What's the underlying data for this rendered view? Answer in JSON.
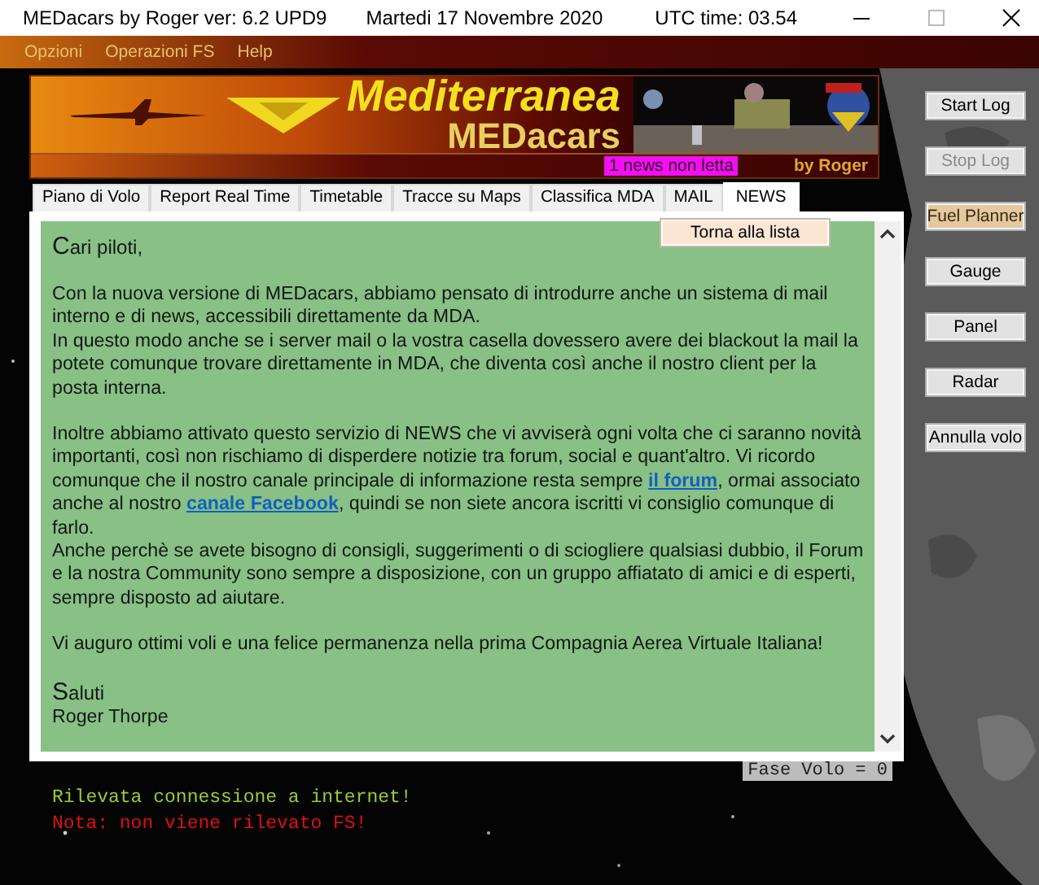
{
  "window": {
    "title": "MEDacars by Roger ver: 6.2 UPD9",
    "date": "Martedi 17 Novembre 2020",
    "utc": "UTC time: 03.54"
  },
  "menu": [
    "Opzioni",
    "Operazioni FS",
    "Help"
  ],
  "banner": {
    "title": "Mediterranea",
    "subtitle": "MEDacars",
    "badge": "1 news non letta",
    "credit": "by Roger"
  },
  "tabs": [
    {
      "label": "Piano di Volo",
      "selected": false
    },
    {
      "label": "Report Real Time",
      "selected": false
    },
    {
      "label": "Timetable",
      "selected": false
    },
    {
      "label": "Tracce su Maps",
      "selected": false
    },
    {
      "label": "Classifica MDA",
      "selected": false
    },
    {
      "label": "MAIL",
      "selected": false
    },
    {
      "label": "NEWS",
      "selected": true
    }
  ],
  "back_button": "Torna alla lista",
  "news": [
    [
      {
        "kind": "heading",
        "parts": [
          {
            "kind": "text",
            "text": "Cari piloti,"
          }
        ]
      }
    ],
    [
      {
        "kind": "text",
        "parts": [
          {
            "kind": "text",
            "text": "Con la nuova versione di MEDacars, abbiamo pensato di introdurre anche un sistema di mail interno e di news, accessibili direttamente da MDA."
          }
        ]
      },
      {
        "kind": "text",
        "parts": [
          {
            "kind": "text",
            "text": "In questo modo anche se i server mail o la vostra casella dovessero avere dei blackout la mail la potete comunque trovare direttamente in MDA, che diventa così anche il nostro client per la posta interna."
          }
        ]
      }
    ],
    [
      {
        "kind": "text",
        "parts": [
          {
            "kind": "text",
            "text": "Inoltre abbiamo attivato questo servizio di NEWS che vi avviserà ogni volta che ci saranno novità importanti, così non rischiamo di disperdere notizie tra forum, social e quant'altro. Vi ricordo comunque che il nostro canale principale di informazione resta sempre "
          },
          {
            "kind": "link",
            "text": "il forum"
          },
          {
            "kind": "text",
            "text": ", ormai associato anche al nostro "
          },
          {
            "kind": "link",
            "text": "canale Facebook"
          },
          {
            "kind": "text",
            "text": ", quindi se non siete ancora iscritti vi consiglio comunque di farlo."
          }
        ]
      },
      {
        "kind": "text",
        "parts": [
          {
            "kind": "text",
            "text": "Anche perchè se avete bisogno di consigli, suggerimenti o di sciogliere qualsiasi dubbio, il Forum e la nostra Community sono sempre a disposizione, con un gruppo affiatato di amici e di esperti, sempre disposto ad aiutare."
          }
        ]
      }
    ],
    [
      {
        "kind": "text",
        "parts": [
          {
            "kind": "text",
            "text": "Vi auguro ottimi voli e una felice permanenza nella prima Compagnia Aerea Virtuale Italiana!"
          }
        ]
      }
    ],
    [
      {
        "kind": "heading",
        "parts": [
          {
            "kind": "text",
            "text": "Saluti"
          }
        ]
      },
      {
        "kind": "text",
        "parts": [
          {
            "kind": "text",
            "text": "Roger Thorpe"
          }
        ]
      }
    ]
  ],
  "flight_phase": "Fase Volo = 0",
  "log": [
    {
      "text": "Rilevata connessione a internet!",
      "color": "#9acd32"
    },
    {
      "text": "Nota: non viene rilevato FS!",
      "color": "#e01010"
    }
  ],
  "buttons": [
    {
      "label": "Start Log",
      "disabled": false,
      "highlighted": false
    },
    {
      "label": "Stop Log",
      "disabled": true,
      "highlighted": false
    },
    {
      "label": "Fuel Planner",
      "disabled": false,
      "highlighted": true
    },
    {
      "label": "Gauge",
      "disabled": false,
      "highlighted": false
    },
    {
      "label": "Panel",
      "disabled": false,
      "highlighted": false
    },
    {
      "label": "Radar",
      "disabled": false,
      "highlighted": false
    },
    {
      "label": "Annulla volo",
      "disabled": false,
      "highlighted": false
    }
  ]
}
